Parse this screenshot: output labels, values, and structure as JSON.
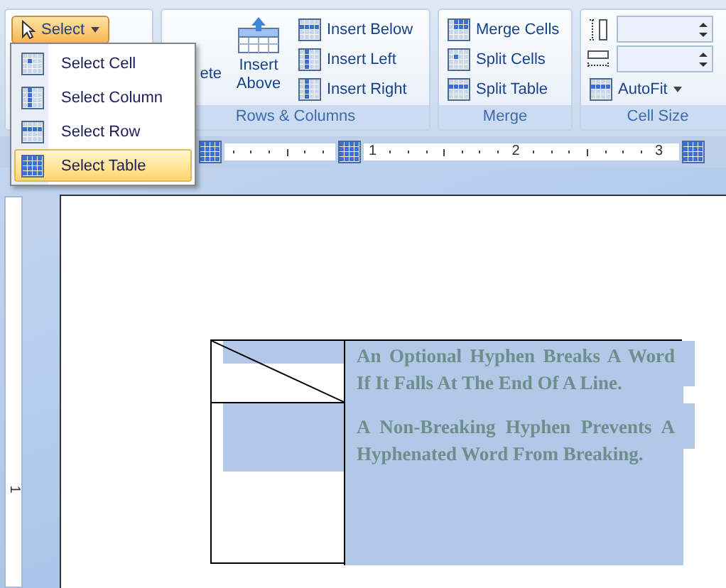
{
  "ribbon": {
    "select_button": {
      "label": "Select",
      "open": true
    },
    "rows_columns": {
      "delete_label": "ete",
      "insert_above": "Insert Above",
      "side_buttons": [
        "Insert Below",
        "Insert Left",
        "Insert Right"
      ],
      "group_label": "Rows & Columns"
    },
    "merge": {
      "buttons": [
        "Merge Cells",
        "Split Cells",
        "Split Table"
      ],
      "group_label": "Merge"
    },
    "cell_size": {
      "autofit": "AutoFit",
      "group_label": "Cell Size"
    }
  },
  "select_menu": {
    "items": [
      {
        "label": "Select Cell",
        "kind": "cell",
        "selected": false
      },
      {
        "label": "Select Column",
        "kind": "column",
        "selected": false
      },
      {
        "label": "Select Row",
        "kind": "row",
        "selected": false
      },
      {
        "label": "Select Table",
        "kind": "table",
        "selected": true
      }
    ]
  },
  "ruler": {
    "numbers": [
      "1",
      "2",
      "3"
    ]
  },
  "vertical_ruler": {
    "number": "1"
  },
  "document": {
    "table": {
      "selected": true,
      "paragraphs": [
        " An Optional Hyphen Breaks A Word If It Falls At The End Of A Line.",
        "A Non-Breaking Hyphen Prevents A Hyphenated Word From Breaking."
      ]
    }
  }
}
